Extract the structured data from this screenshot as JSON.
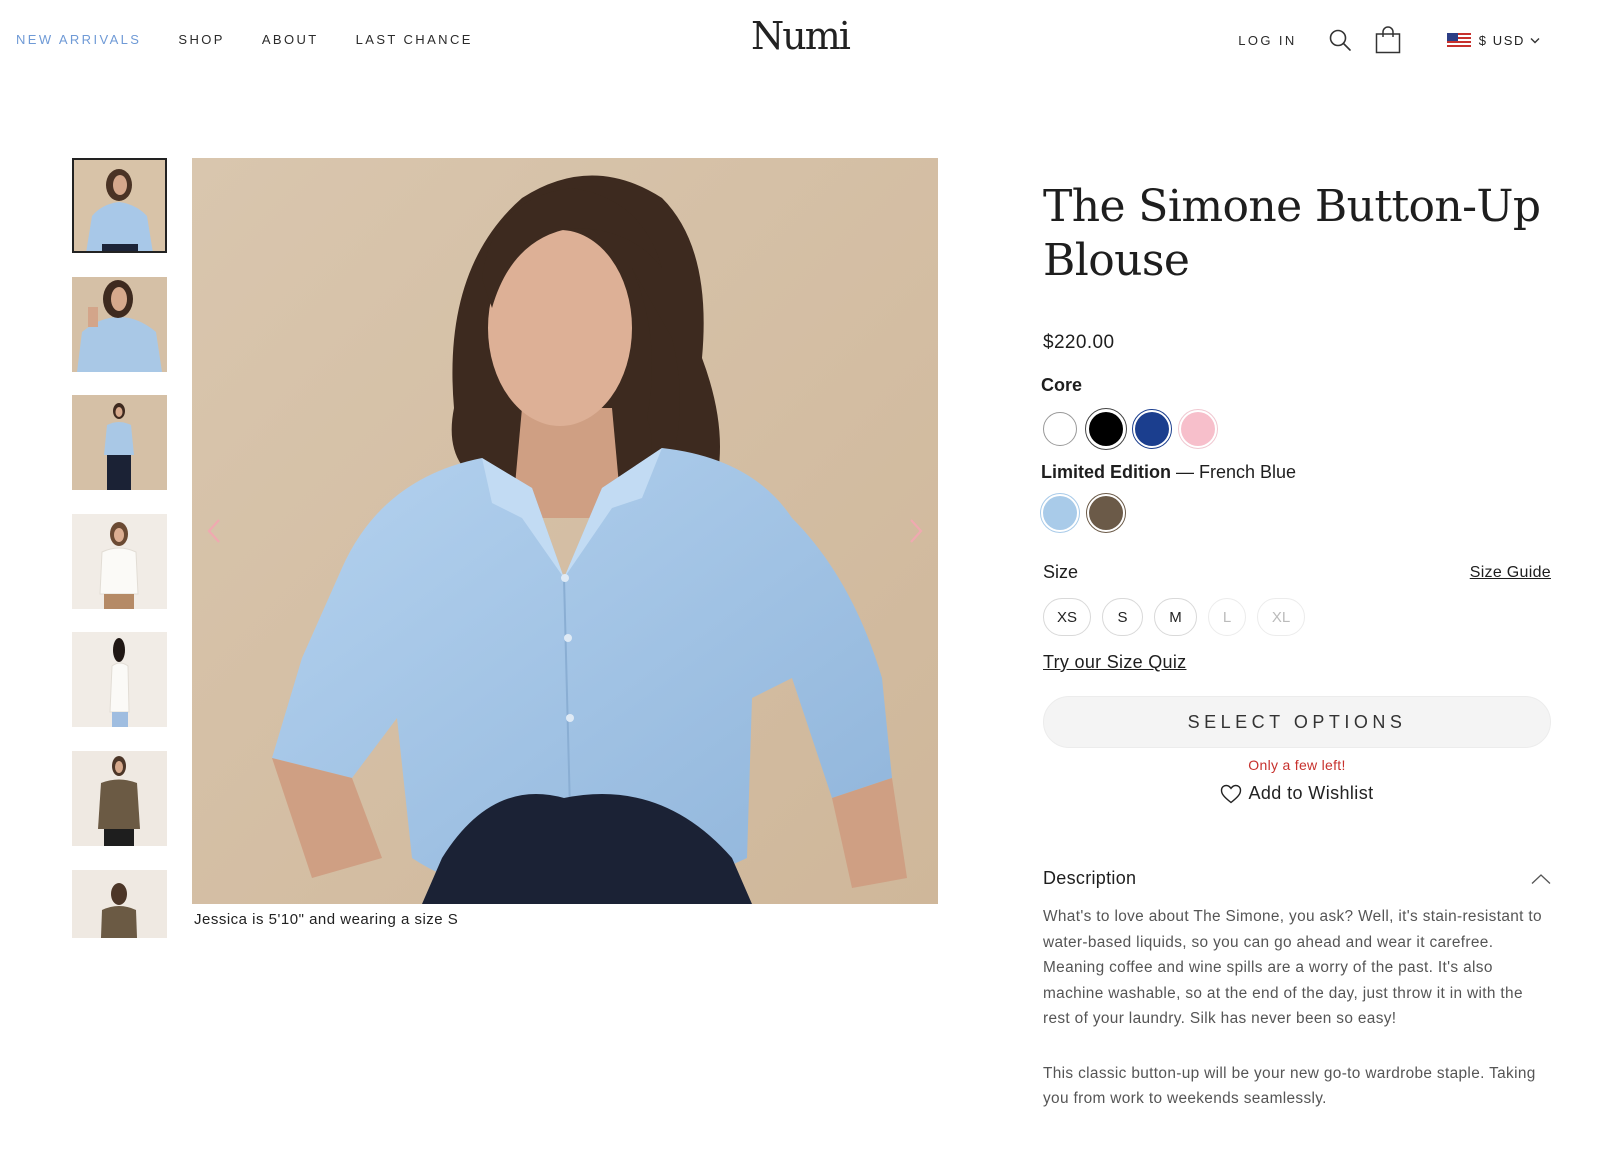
{
  "header": {
    "nav_left": [
      "NEW ARRIVALS",
      "SHOP",
      "ABOUT",
      "LAST CHANCE"
    ],
    "logo": "Numi",
    "login": "LOG IN",
    "currency": "$ USD",
    "accent_color": "#6f9ad6",
    "icons": [
      "search-icon",
      "shopping-bag-icon",
      "us-flag-icon",
      "chevron-down-icon"
    ]
  },
  "gallery": {
    "thumbnail_count": 7,
    "active_thumbnail": 1,
    "caption": "Jessica is 5'10\" and wearing a size S"
  },
  "product": {
    "title": "The Simone Button-Up Blouse",
    "price": "$220.00",
    "core_label": "Core",
    "core_colors": [
      "#ffffff",
      "#000000",
      "#1b3e8e",
      "#f7bfcb"
    ],
    "core_selected": "#000000",
    "limited_label": "Limited Edition",
    "limited_separator": " — ",
    "limited_color_name": "French Blue",
    "limited_colors": [
      "#a9cbe9",
      "#6b5a48"
    ],
    "size_label": "Size",
    "size_guide": "Size Guide",
    "sizes": [
      {
        "label": "XS",
        "available": true
      },
      {
        "label": "S",
        "available": true
      },
      {
        "label": "M",
        "available": true
      },
      {
        "label": "L",
        "available": false
      },
      {
        "label": "XL",
        "available": false
      }
    ],
    "size_quiz": "Try our Size Quiz",
    "select_button": "SELECT OPTIONS",
    "stock_note": "Only a few left!",
    "wishlist": "Add to Wishlist",
    "description_heading": "Description",
    "description": [
      "What's to love about The Simone, you ask? Well, it's stain-resistant to water-based liquids, so you can go ahead and wear it carefree. Meaning coffee and wine spills are a worry of the past. It's also machine washable, so at the end of the day, just throw it in with the rest of your laundry. Silk has never been so easy!",
      "This classic button-up will be your new go-to wardrobe staple. Taking you from work to weekends seamlessly."
    ]
  }
}
